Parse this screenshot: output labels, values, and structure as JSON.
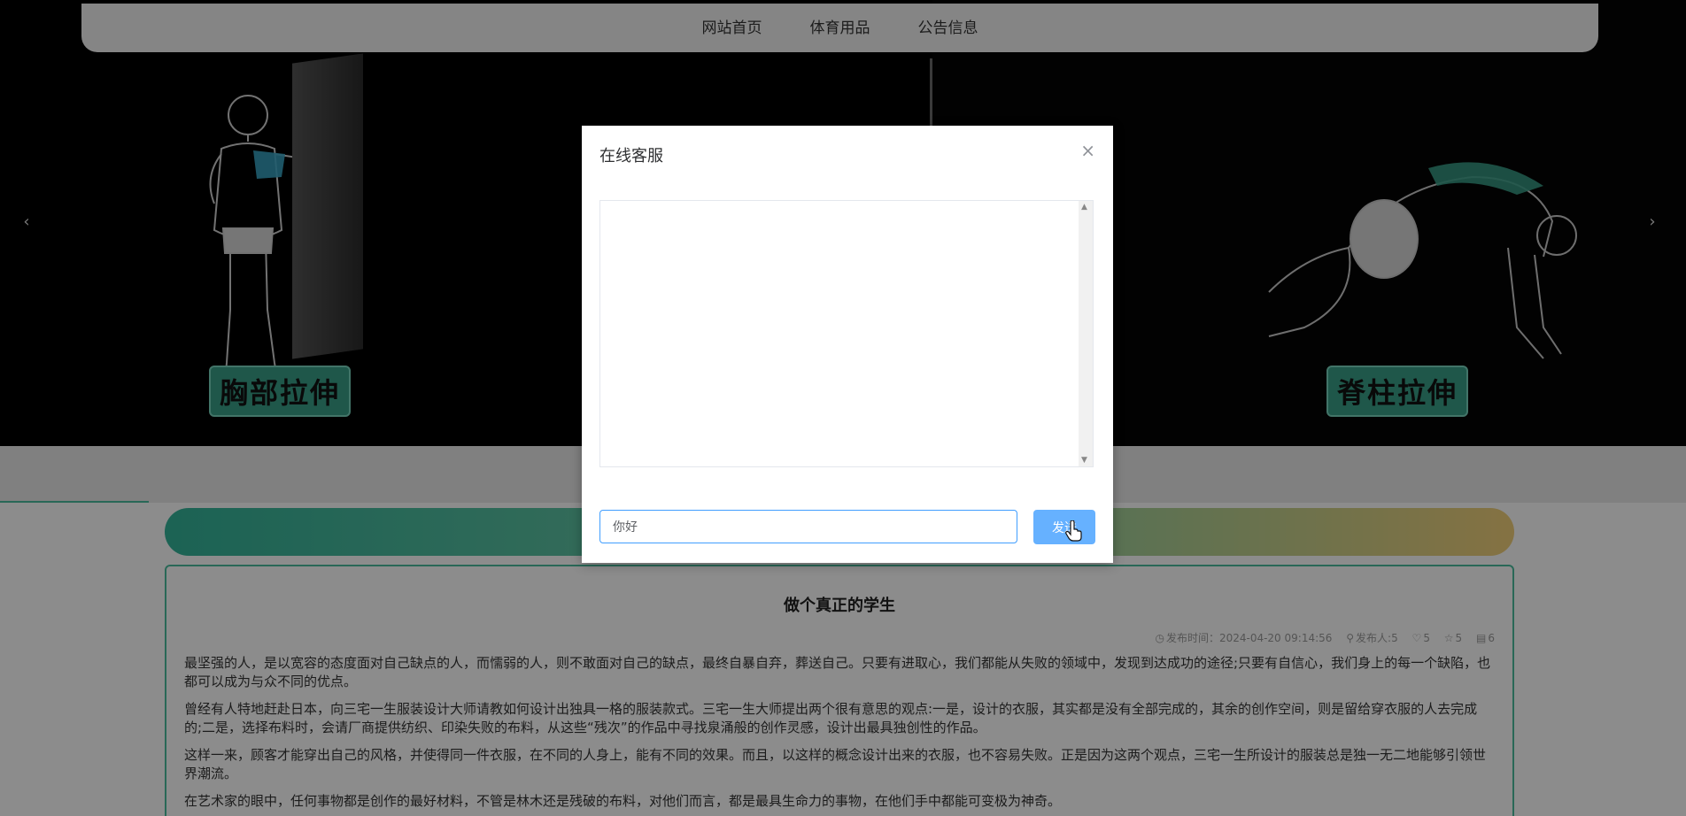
{
  "nav": {
    "items": [
      {
        "label": "网站首页"
      },
      {
        "label": "体育用品"
      },
      {
        "label": "公告信息"
      }
    ]
  },
  "carousel": {
    "left_badge": "胸部拉伸",
    "right_badge": "脊柱拉伸",
    "prev_arrow": "‹",
    "next_arrow": "›"
  },
  "article": {
    "title": "做个真正的学生",
    "meta": {
      "publish_time": "发布时间：2024-04-20 09:14:56",
      "author": "发布人:5",
      "likes": "5",
      "favorites": "5",
      "views": "6"
    },
    "paragraphs": [
      "最坚强的人，是以宽容的态度面对自己缺点的人，而懦弱的人，则不敢面对自己的缺点，最终自暴自弃，葬送自己。只要有进取心，我们都能从失败的领域中，发现到达成功的途径;只要有自信心，我们身上的每一个缺陷，也都可以成为与众不同的优点。",
      "曾经有人特地赶赴日本，向三宅一生服装设计大师请教如何设计出独具一格的服装款式。三宅一生大师提出两个很有意思的观点:一是，设计的衣服，其实都是没有全部完成的，其余的创作空间，则是留给穿衣服的人去完成的;二是，选择布料时，会请厂商提供纺织、印染失败的布料，从这些“残次”的作品中寻找泉涌般的创作灵感，设计出最具独创性的作品。",
      "这样一来，顾客才能穿出自己的风格，并使得同一件衣服，在不同的人身上，能有不同的效果。而且，以这样的概念设计出来的衣服，也不容易失败。正是因为这两个观点，三宅一生所设计的服装总是独一无二地能够引领世界潮流。",
      "在艺术家的眼中，任何事物都是创作的最好材料，不管是林木还是残破的布料，对他们而言，都是最具生命力的事物，在他们手中都能可变极为神奇。"
    ]
  },
  "dialog": {
    "title": "在线客服",
    "close_symbol": "×",
    "input_value": "你好",
    "send_label": "发送",
    "scroll_up": "▲",
    "scroll_down": "▼"
  },
  "colors": {
    "accent": "#4bbd9f",
    "send_button": "#66b1ff",
    "input_focus": "#409eff"
  }
}
